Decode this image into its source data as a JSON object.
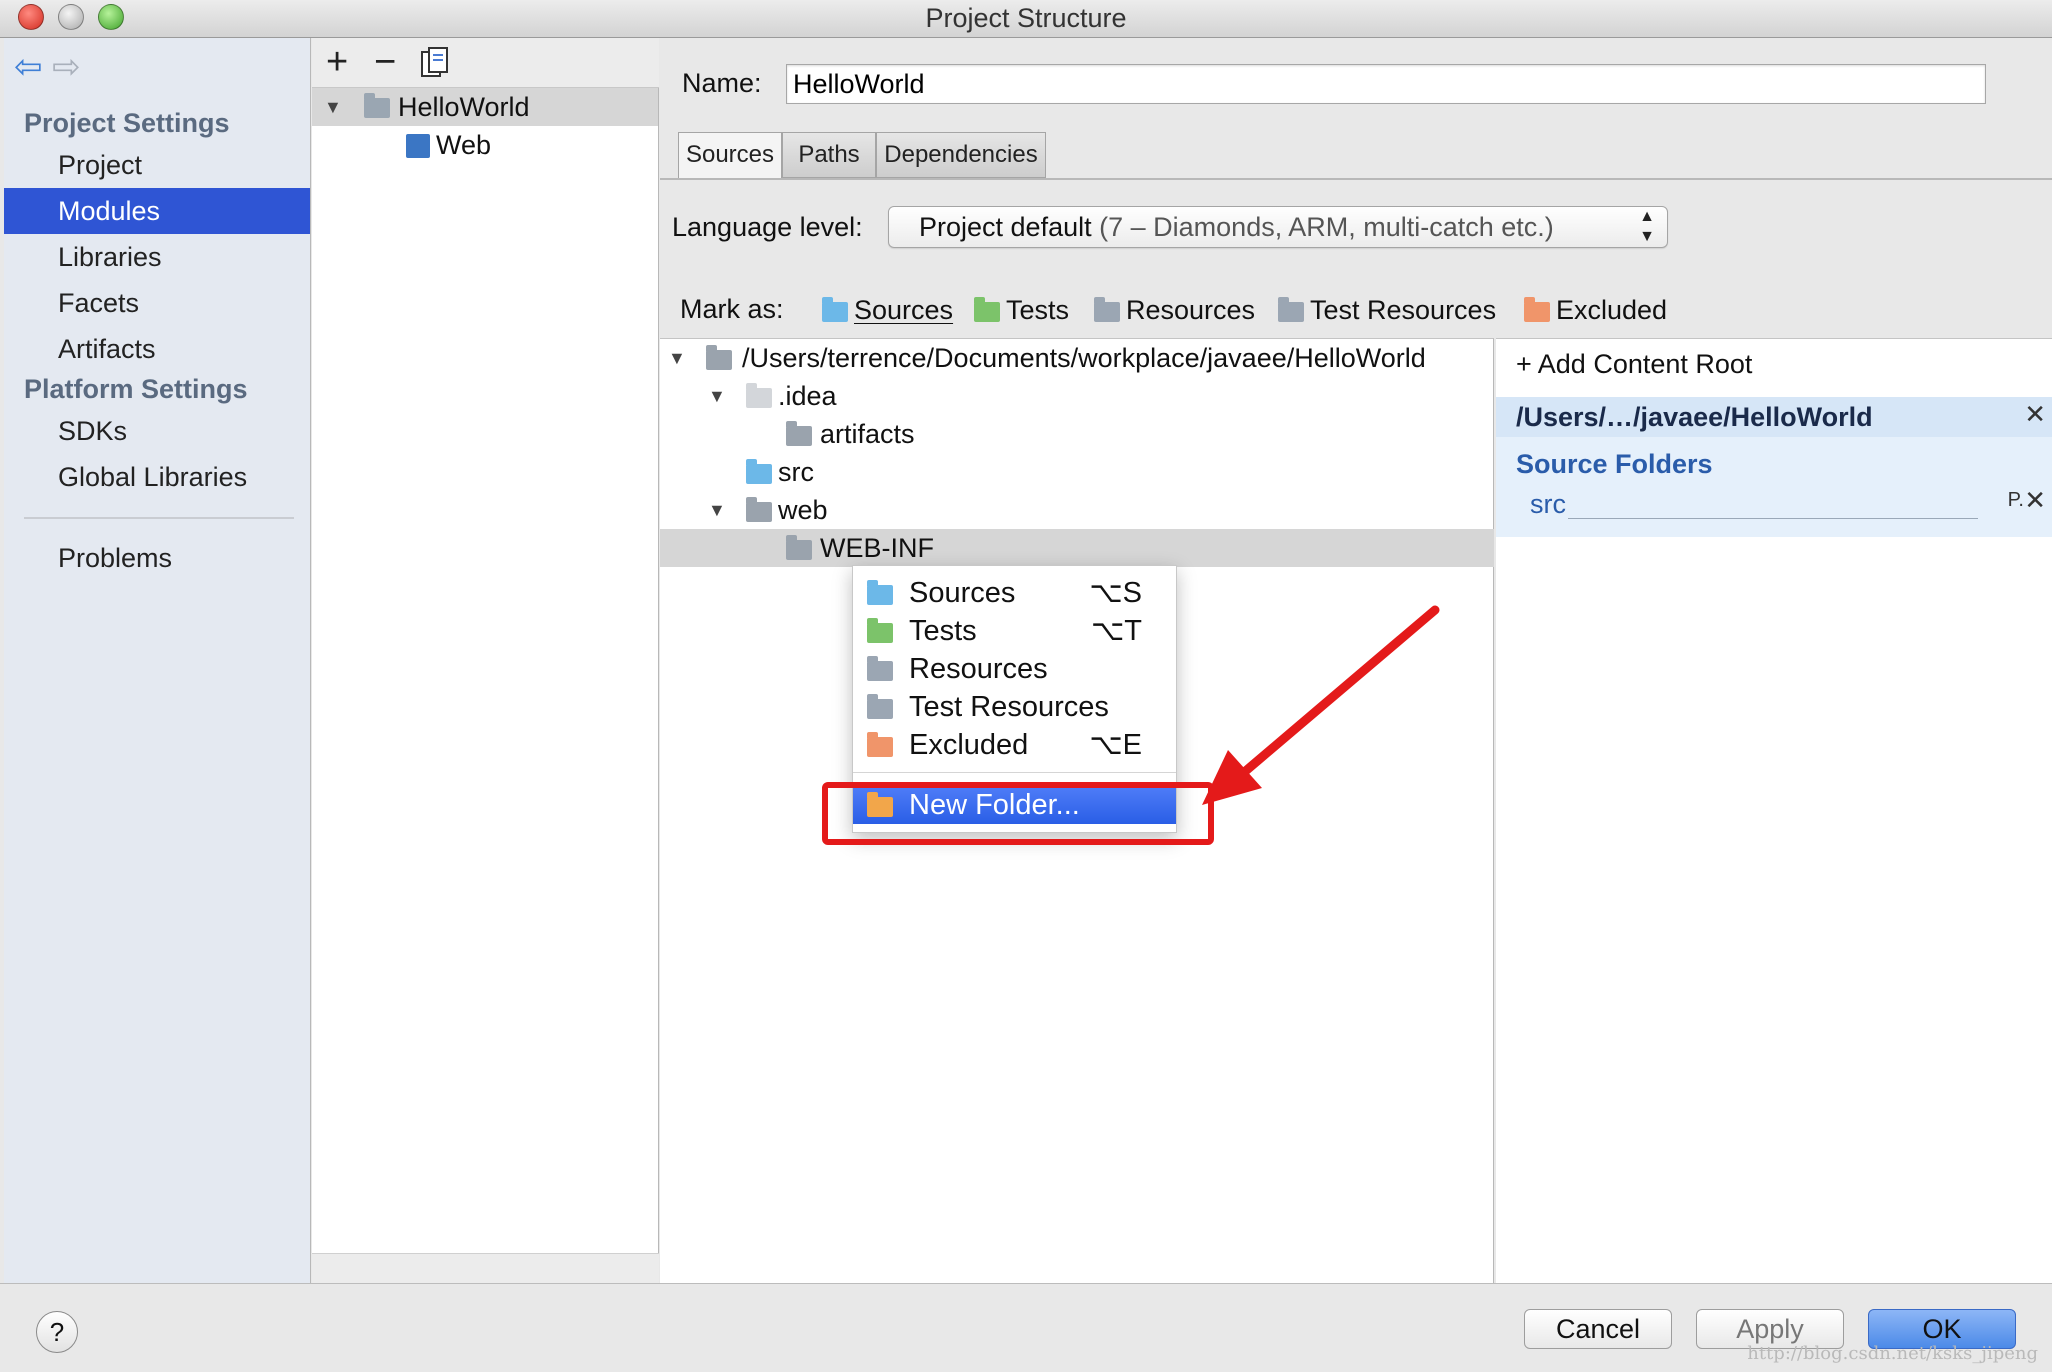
{
  "window": {
    "title": "Project Structure"
  },
  "sidebar": {
    "project_settings_header": "Project Settings",
    "project_items": [
      "Project",
      "Modules",
      "Libraries",
      "Facets",
      "Artifacts"
    ],
    "platform_settings_header": "Platform Settings",
    "platform_items": [
      "SDKs",
      "Global Libraries"
    ],
    "problems": "Problems"
  },
  "module_tree": {
    "toolbar": {
      "add": "+",
      "remove": "−"
    },
    "items": [
      "HelloWorld",
      "Web"
    ]
  },
  "main": {
    "name_label": "Name:",
    "name_value": "HelloWorld",
    "tabs": [
      "Sources",
      "Paths",
      "Dependencies"
    ],
    "language_level_label": "Language level:",
    "language_level_value": "Project default",
    "language_level_detail": "(7 – Diamonds, ARM, multi-catch etc.)",
    "mark_as_label": "Mark as:",
    "mark_as": [
      {
        "label": "Sources",
        "color": "#6cb8e8"
      },
      {
        "label": "Tests",
        "color": "#7cc36a"
      },
      {
        "label": "Resources",
        "color": "#9ba6b3"
      },
      {
        "label": "Test Resources",
        "color": "#9ba6b3"
      },
      {
        "label": "Excluded",
        "color": "#f0956a"
      }
    ]
  },
  "content_tree": {
    "rows": [
      "/Users/terrence/Documents/workplace/javaee/HelloWorld",
      ".idea",
      "artifacts",
      "src",
      "web",
      "WEB-INF"
    ]
  },
  "content_root": {
    "add_label": "+ Add Content Root",
    "root_path": "/Users/…/javaee/HelloWorld",
    "source_folders_header": "Source Folders",
    "source_item": "src",
    "source_item_props": "P."
  },
  "context_menu": {
    "items": [
      {
        "label": "Sources",
        "shortcut": "⌥S"
      },
      {
        "label": "Tests",
        "shortcut": "⌥T"
      },
      {
        "label": "Resources",
        "shortcut": ""
      },
      {
        "label": "Test Resources",
        "shortcut": ""
      },
      {
        "label": "Excluded",
        "shortcut": "⌥E"
      }
    ],
    "new_folder": "New Folder..."
  },
  "dialog_buttons": {
    "help": "?",
    "cancel": "Cancel",
    "apply": "Apply",
    "ok": "OK"
  },
  "watermark": "http://blog.csdn.net/ksks_jipeng",
  "colors": {
    "accent": "#2f55d4",
    "highlight": "#e41a1a"
  }
}
